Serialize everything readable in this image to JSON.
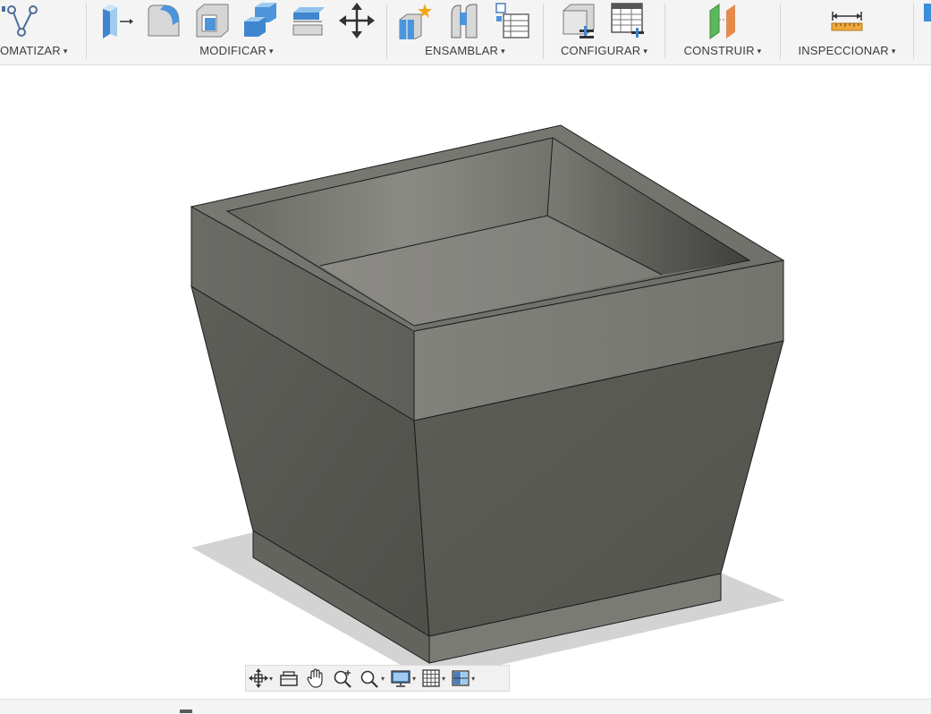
{
  "toolbar": {
    "groups": [
      {
        "label": "OMATIZAR",
        "tools": [
          "sketch-constraint-icon"
        ]
      },
      {
        "label": "MODIFICAR",
        "tools": [
          "press-pull-icon",
          "fillet-icon",
          "shell-icon",
          "combine-icon",
          "replace-face-icon",
          "move-icon"
        ]
      },
      {
        "label": "ENSAMBLAR",
        "tools": [
          "new-component-icon",
          "joint-icon",
          "table-icon"
        ]
      },
      {
        "label": "CONFIGURAR",
        "tools": [
          "configure-icon",
          "parameters-table-icon"
        ]
      },
      {
        "label": "CONSTRUIR",
        "tools": [
          "offset-plane-icon"
        ]
      },
      {
        "label": "INSPECCIONAR",
        "tools": [
          "measure-icon"
        ]
      }
    ],
    "caret": "▾"
  },
  "navbar": {
    "items": [
      "orbit-icon",
      "look-at-icon",
      "pan-icon",
      "zoom-icon",
      "zoom-window-icon",
      "display-settings-icon",
      "grid-icon",
      "viewports-icon"
    ]
  },
  "colors": {
    "toolbar_bg": "#f4f4f4",
    "model_face_dark": "#5c5c56",
    "model_face_light": "#7b7b74",
    "accent_blue": "#3b8ed8",
    "construct_green": "#5cb85c",
    "construct_orange": "#e38b4f"
  }
}
